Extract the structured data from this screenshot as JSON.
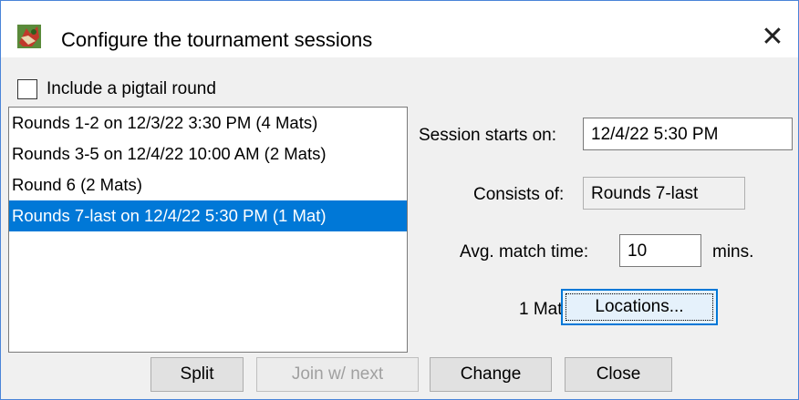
{
  "window": {
    "title": "Configure the tournament sessions",
    "close_glyph": "✕"
  },
  "pigtail": {
    "label": "Include a pigtail round",
    "checked": false
  },
  "sessions": [
    {
      "label": "Rounds 1-2 on 12/3/22 3:30 PM (4 Mats)",
      "selected": false
    },
    {
      "label": "Rounds 3-5 on 12/4/22 10:00 AM (2 Mats)",
      "selected": false
    },
    {
      "label": "Round 6 (2 Mats)",
      "selected": false
    },
    {
      "label": "Rounds 7-last on 12/4/22 5:30 PM (1 Mat)",
      "selected": true
    }
  ],
  "details": {
    "starts_label": "Session starts on:",
    "starts_value": "12/4/22 5:30 PM",
    "consists_label": "Consists of:",
    "consists_value": "Rounds 7-last",
    "avg_label": "Avg. match time:",
    "avg_value": "10",
    "avg_unit": "mins.",
    "mats_label": "1 Mat",
    "locations_label": "Locations..."
  },
  "buttons": {
    "split": "Split",
    "join": "Join w/ next",
    "change": "Change",
    "close": "Close"
  },
  "colors": {
    "selection": "#0078d7",
    "window_border": "#4a84d8",
    "dialog_bg": "#f0f0f0"
  },
  "icons": {
    "app": "tournament-app-icon",
    "close": "close-icon"
  }
}
